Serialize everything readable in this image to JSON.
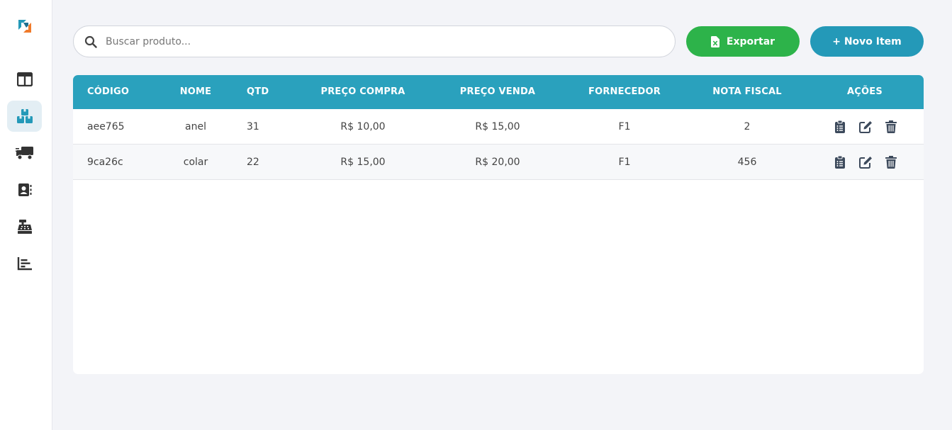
{
  "sidebar": {
    "items": [
      {
        "icon": "dashboard-icon"
      },
      {
        "icon": "boxes-icon",
        "active": true
      },
      {
        "icon": "truck-icon"
      },
      {
        "icon": "contacts-icon"
      },
      {
        "icon": "cash-register-icon"
      },
      {
        "icon": "bar-chart-icon"
      }
    ],
    "active_color": "#2499b8"
  },
  "search": {
    "placeholder": "Buscar produto...",
    "value": ""
  },
  "toolbar": {
    "export_label": "Exportar",
    "new_label": "+ Novo Item"
  },
  "colors": {
    "export": "#2db34a",
    "new": "#2499b8",
    "header": "#2aa1bd"
  },
  "table": {
    "headers": [
      "CÓDIGO",
      "NOME",
      "QTD",
      "PREÇO COMPRA",
      "PREÇO VENDA",
      "FORNECEDOR",
      "NOTA FISCAL",
      "AÇÕES"
    ],
    "rows": [
      {
        "codigo": "aee765",
        "nome": "anel",
        "qtd": "31",
        "preco_compra": "R$ 10,00",
        "preco_venda": "R$ 15,00",
        "fornecedor": "F1",
        "nota_fiscal": "2"
      },
      {
        "codigo": "9ca26c",
        "nome": "colar",
        "qtd": "22",
        "preco_compra": "R$ 15,00",
        "preco_venda": "R$ 20,00",
        "fornecedor": "F1",
        "nota_fiscal": "456"
      }
    ]
  }
}
